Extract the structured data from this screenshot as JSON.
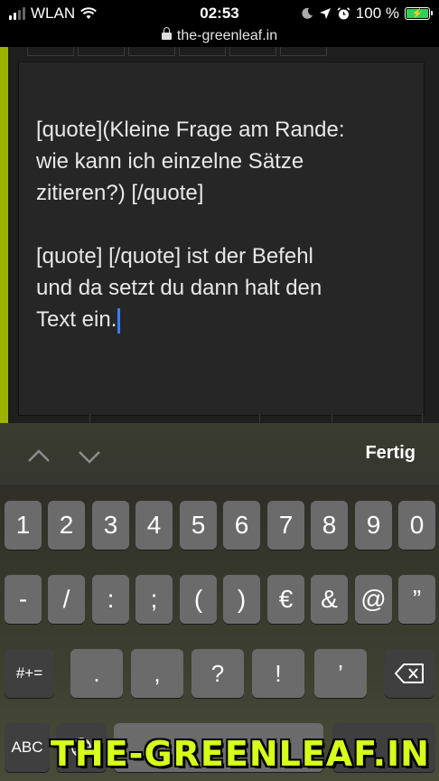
{
  "status_bar": {
    "carrier": "WLAN",
    "time": "02:53",
    "battery_percent": "100 %"
  },
  "url_bar": {
    "domain": "the-greenleaf.in"
  },
  "editor": {
    "text": "[quote](Kleine Frage am Rande:\nwie kann ich einzelne Sätze\nzitieren?) [/quote]\n\n[quote] [/quote] ist der Befehl\nund da setzt du dann halt den\nText ein."
  },
  "accessory": {
    "done_label": "Fertig"
  },
  "keyboard": {
    "row1": [
      "1",
      "2",
      "3",
      "4",
      "5",
      "6",
      "7",
      "8",
      "9",
      "0"
    ],
    "row2": [
      "-",
      "/",
      ":",
      ";",
      "(",
      ")",
      "€",
      "&",
      "@",
      "”"
    ],
    "row3_symbols": [
      "#+="
    ],
    "row3": [
      ".",
      ",",
      "?",
      "!",
      "’"
    ],
    "row4_abc": "ABC"
  },
  "watermark": "THE-GREENLEAF.IN",
  "colors": {
    "accent_green": "#9ab400",
    "caret": "#3a7bff",
    "watermark": "#d6ff1a"
  }
}
